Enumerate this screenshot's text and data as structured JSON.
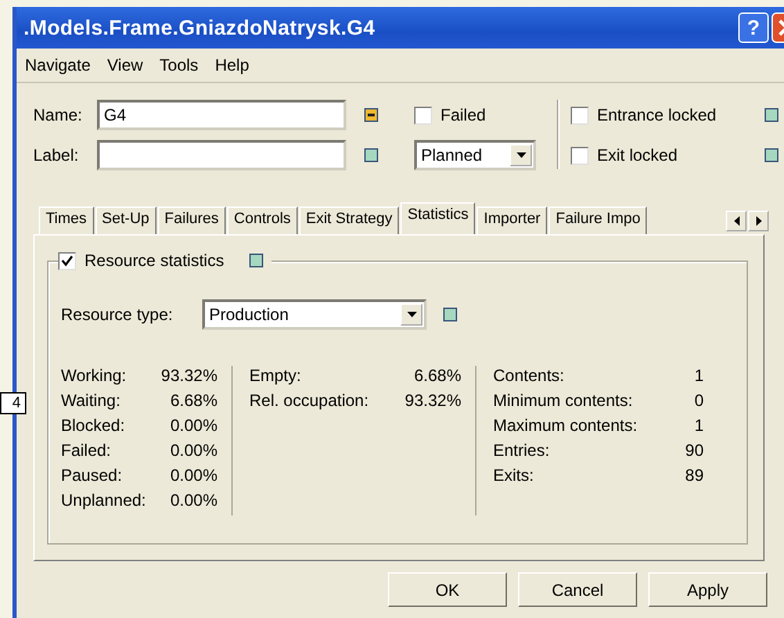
{
  "window": {
    "title": ".Models.Frame.GniazdoNatrysk.G4",
    "help_button": "?"
  },
  "menu": [
    "Navigate",
    "View",
    "Tools",
    "Help"
  ],
  "name_field": {
    "label": "Name:",
    "value": "G4"
  },
  "label_field": {
    "label": "Label:"
  },
  "failed": {
    "label": "Failed",
    "checked": false
  },
  "plan_select": {
    "value": "Planned"
  },
  "entrance_locked": {
    "label": "Entrance locked",
    "checked": false
  },
  "exit_locked": {
    "label": "Exit locked",
    "checked": false
  },
  "tabs": [
    {
      "label": "Times",
      "selected": false
    },
    {
      "label": "Set-Up",
      "selected": false
    },
    {
      "label": "Failures",
      "selected": false
    },
    {
      "label": "Controls",
      "selected": false
    },
    {
      "label": "Exit Strategy",
      "selected": false
    },
    {
      "label": "Statistics",
      "selected": true
    },
    {
      "label": "Importer",
      "selected": false
    },
    {
      "label": "Failure Impo",
      "selected": false
    }
  ],
  "resource_statistics": {
    "label": "Resource statistics",
    "checked": true
  },
  "resource_type": {
    "label": "Resource type:",
    "value": "Production"
  },
  "stats_columns": [
    [
      {
        "label": "Working:",
        "value": "93.32%"
      },
      {
        "label": "Waiting:",
        "value": "6.68%"
      },
      {
        "label": "Blocked:",
        "value": "0.00%"
      },
      {
        "label": "Failed:",
        "value": "0.00%"
      },
      {
        "label": "Paused:",
        "value": "0.00%"
      },
      {
        "label": "Unplanned:",
        "value": "0.00%"
      }
    ],
    [
      {
        "label": "Empty:",
        "value": "6.68%"
      },
      {
        "label": "Rel. occupation:",
        "value": "93.32%"
      }
    ],
    [
      {
        "label": "Contents:",
        "value": "1"
      },
      {
        "label": "Minimum contents:",
        "value": "0"
      },
      {
        "label": "Maximum contents:",
        "value": "1"
      },
      {
        "label": "Entries:",
        "value": "90"
      },
      {
        "label": "Exits:",
        "value": "89"
      }
    ]
  ],
  "buttons": [
    "OK",
    "Cancel",
    "Apply"
  ],
  "side_tag": "4"
}
